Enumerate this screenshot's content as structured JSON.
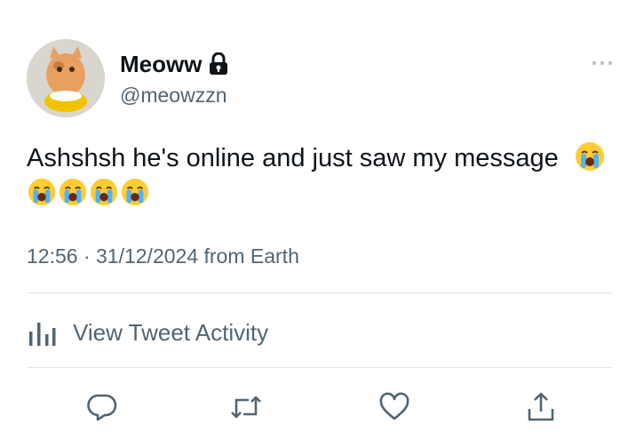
{
  "tweet": {
    "display_name": "Meoww",
    "handle": "@meowzzn",
    "text": "Ashshsh he's online and just saw my message",
    "emojis_inline": [
      "loudly-crying-face"
    ],
    "emojis_second_line": [
      "loudly-crying-face",
      "loudly-crying-face",
      "loudly-crying-face",
      "loudly-crying-face"
    ],
    "timestamp": "12:56 · 31/12/2024",
    "source": "from Earth",
    "meta_line": "12:56 · 31/12/2024 from Earth"
  },
  "activity": {
    "label": "View Tweet Activity"
  },
  "icons": {
    "account": "lock-icon",
    "more": "more-dots-icon",
    "activity": "bar-chart-icon",
    "reply": "reply-icon",
    "retweet": "retweet-icon",
    "like": "heart-icon",
    "share": "share-icon"
  },
  "colors": {
    "text_primary": "#0f1419",
    "text_secondary": "#536471",
    "divider": "#e1e8ed"
  }
}
